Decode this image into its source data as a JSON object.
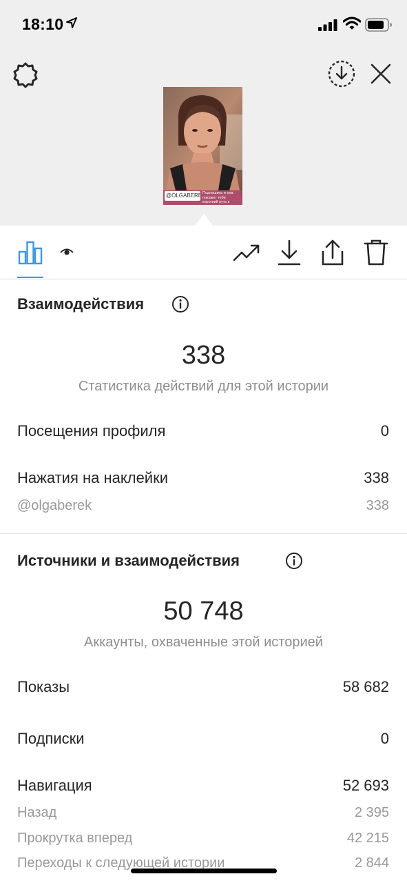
{
  "status_bar": {
    "time": "18:10"
  },
  "story_header": {
    "settings_icon": "gear-icon",
    "download_icon": "download-circle-icon",
    "close_icon": "close-icon",
    "thumbnail": {
      "sticker_handle": "@OLGABEREK",
      "sticker_text": "Подпишись и она покажет тебе короткий путь к"
    }
  },
  "tabs": [
    {
      "icon": "bar-chart-icon",
      "active": true
    },
    {
      "icon": "eye-icon",
      "active": false
    }
  ],
  "actions": [
    "trending-icon",
    "download-icon",
    "share-icon",
    "trash-icon"
  ],
  "interactions": {
    "title": "Взаимодействия",
    "total": "338",
    "caption": "Статистика действий для этой истории",
    "rows": [
      {
        "label": "Посещения профиля",
        "value": "0"
      },
      {
        "label": "Нажатия на наклейки",
        "value": "338"
      }
    ],
    "sub_rows": [
      {
        "label": "@olgaberek",
        "value": "338"
      }
    ]
  },
  "discovery": {
    "title": "Источники и взаимодействия",
    "total": "50 748",
    "caption": "Аккаунты, охваченные этой историей",
    "rows": [
      {
        "label": "Показы",
        "value": "58 682"
      },
      {
        "label": "Подписки",
        "value": "0"
      },
      {
        "label": "Навигация",
        "value": "52 693"
      }
    ],
    "navigation_rows": [
      {
        "label": "Назад",
        "value": "2 395"
      },
      {
        "label": "Прокрутка вперед",
        "value": "42 215"
      },
      {
        "label": "Переходы к следующей истории",
        "value": "2 844"
      }
    ]
  },
  "colors": {
    "accent": "#3897f0",
    "header_bg": "#efefef",
    "secondary_text": "#8e8e8e"
  }
}
